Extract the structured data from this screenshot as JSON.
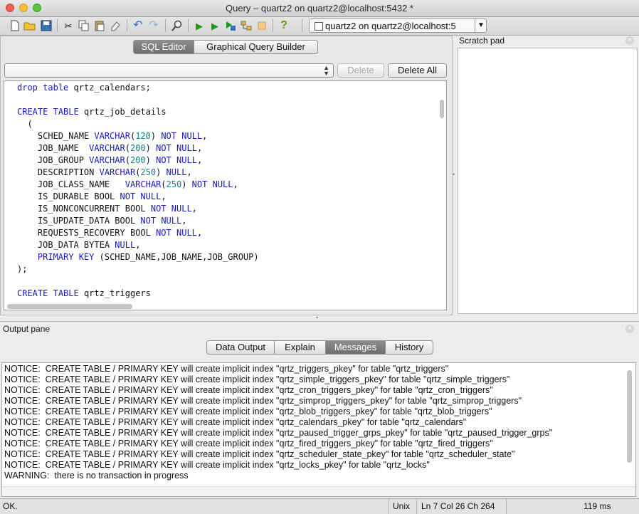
{
  "window": {
    "title": "Query – quartz2 on quartz2@localhost:5432 *"
  },
  "toolbar": {
    "icons": [
      "new-file-icon",
      "open-folder-icon",
      "save-icon",
      "cut-icon",
      "copy-icon",
      "paste-icon",
      "clear-icon",
      "undo-icon",
      "redo-icon",
      "find-icon",
      "execute-icon",
      "execute-pgscript-icon",
      "execute-to-file-icon",
      "explain-icon",
      "cancel-icon",
      "help-icon"
    ],
    "connection": "quartz2 on quartz2@localhost:5"
  },
  "editor": {
    "tabs": [
      {
        "label": "SQL Editor",
        "active": true
      },
      {
        "label": "Graphical Query Builder",
        "active": false
      }
    ],
    "delete_label": "Delete",
    "delete_all_label": "Delete All",
    "code": [
      [
        [
          "kw",
          "drop"
        ],
        [
          "t",
          " "
        ],
        [
          "kw",
          "table"
        ],
        [
          "t",
          " qrtz_calendars;"
        ]
      ],
      [],
      [
        [
          "kw",
          "CREATE"
        ],
        [
          "t",
          " "
        ],
        [
          "kw",
          "TABLE"
        ],
        [
          "t",
          " qrtz_job_details"
        ]
      ],
      [
        [
          "t",
          "  ("
        ]
      ],
      [
        [
          "t",
          "    SCHED_NAME "
        ],
        [
          "kw",
          "VARCHAR"
        ],
        [
          "t",
          "("
        ],
        [
          "num",
          "120"
        ],
        [
          "t",
          ") "
        ],
        [
          "kw",
          "NOT"
        ],
        [
          "t",
          " "
        ],
        [
          "kw",
          "NULL"
        ],
        [
          "t",
          ","
        ]
      ],
      [
        [
          "t",
          "    JOB_NAME  "
        ],
        [
          "kw",
          "VARCHAR"
        ],
        [
          "t",
          "("
        ],
        [
          "num",
          "200"
        ],
        [
          "t",
          ") "
        ],
        [
          "kw",
          "NOT"
        ],
        [
          "t",
          " "
        ],
        [
          "kw",
          "NULL"
        ],
        [
          "t",
          ","
        ]
      ],
      [
        [
          "t",
          "    JOB_GROUP "
        ],
        [
          "kw",
          "VARCHAR"
        ],
        [
          "t",
          "("
        ],
        [
          "num",
          "200"
        ],
        [
          "t",
          ") "
        ],
        [
          "kw",
          "NOT"
        ],
        [
          "t",
          " "
        ],
        [
          "kw",
          "NULL"
        ],
        [
          "t",
          ","
        ]
      ],
      [
        [
          "t",
          "    DESCRIPTION "
        ],
        [
          "kw",
          "VARCHAR"
        ],
        [
          "t",
          "("
        ],
        [
          "num",
          "250"
        ],
        [
          "t",
          ") "
        ],
        [
          "kw",
          "NULL"
        ],
        [
          "t",
          ","
        ]
      ],
      [
        [
          "t",
          "    JOB_CLASS_NAME   "
        ],
        [
          "kw",
          "VARCHAR"
        ],
        [
          "t",
          "("
        ],
        [
          "num",
          "250"
        ],
        [
          "t",
          ") "
        ],
        [
          "kw",
          "NOT"
        ],
        [
          "t",
          " "
        ],
        [
          "kw",
          "NULL"
        ],
        [
          "t",
          ","
        ]
      ],
      [
        [
          "t",
          "    IS_DURABLE BOOL "
        ],
        [
          "kw",
          "NOT"
        ],
        [
          "t",
          " "
        ],
        [
          "kw",
          "NULL"
        ],
        [
          "t",
          ","
        ]
      ],
      [
        [
          "t",
          "    IS_NONCONCURRENT BOOL "
        ],
        [
          "kw",
          "NOT"
        ],
        [
          "t",
          " "
        ],
        [
          "kw",
          "NULL"
        ],
        [
          "t",
          ","
        ]
      ],
      [
        [
          "t",
          "    IS_UPDATE_DATA BOOL "
        ],
        [
          "kw",
          "NOT"
        ],
        [
          "t",
          " "
        ],
        [
          "kw",
          "NULL"
        ],
        [
          "t",
          ","
        ]
      ],
      [
        [
          "t",
          "    REQUESTS_RECOVERY BOOL "
        ],
        [
          "kw",
          "NOT"
        ],
        [
          "t",
          " "
        ],
        [
          "kw",
          "NULL"
        ],
        [
          "t",
          ","
        ]
      ],
      [
        [
          "t",
          "    JOB_DATA BYTEA "
        ],
        [
          "kw",
          "NULL"
        ],
        [
          "t",
          ","
        ]
      ],
      [
        [
          "t",
          "    "
        ],
        [
          "kw",
          "PRIMARY"
        ],
        [
          "t",
          " "
        ],
        [
          "kw",
          "KEY"
        ],
        [
          "t",
          " (SCHED_NAME,JOB_NAME,JOB_GROUP)"
        ]
      ],
      [
        [
          "t",
          ");"
        ]
      ],
      [],
      [
        [
          "kw",
          "CREATE"
        ],
        [
          "t",
          " "
        ],
        [
          "kw",
          "TABLE"
        ],
        [
          "t",
          " qrtz_triggers"
        ]
      ]
    ]
  },
  "scratch": {
    "title": "Scratch pad"
  },
  "output": {
    "title": "Output pane",
    "tabs": [
      {
        "label": "Data Output",
        "active": false
      },
      {
        "label": "Explain",
        "active": false
      },
      {
        "label": "Messages",
        "active": true
      },
      {
        "label": "History",
        "active": false
      }
    ],
    "messages": [
      "NOTICE:  CREATE TABLE / PRIMARY KEY will create implicit index \"qrtz_triggers_pkey\" for table \"qrtz_triggers\"",
      "NOTICE:  CREATE TABLE / PRIMARY KEY will create implicit index \"qrtz_simple_triggers_pkey\" for table \"qrtz_simple_triggers\"",
      "NOTICE:  CREATE TABLE / PRIMARY KEY will create implicit index \"qrtz_cron_triggers_pkey\" for table \"qrtz_cron_triggers\"",
      "NOTICE:  CREATE TABLE / PRIMARY KEY will create implicit index \"qrtz_simprop_triggers_pkey\" for table \"qrtz_simprop_triggers\"",
      "NOTICE:  CREATE TABLE / PRIMARY KEY will create implicit index \"qrtz_blob_triggers_pkey\" for table \"qrtz_blob_triggers\"",
      "NOTICE:  CREATE TABLE / PRIMARY KEY will create implicit index \"qrtz_calendars_pkey\" for table \"qrtz_calendars\"",
      "NOTICE:  CREATE TABLE / PRIMARY KEY will create implicit index \"qrtz_paused_trigger_grps_pkey\" for table \"qrtz_paused_trigger_grps\"",
      "NOTICE:  CREATE TABLE / PRIMARY KEY will create implicit index \"qrtz_fired_triggers_pkey\" for table \"qrtz_fired_triggers\"",
      "NOTICE:  CREATE TABLE / PRIMARY KEY will create implicit index \"qrtz_scheduler_state_pkey\" for table \"qrtz_scheduler_state\"",
      "NOTICE:  CREATE TABLE / PRIMARY KEY will create implicit index \"qrtz_locks_pkey\" for table \"qrtz_locks\"",
      "WARNING:  there is no transaction in progress"
    ]
  },
  "status": {
    "state": "OK.",
    "eol": "Unix",
    "position": "Ln 7 Col 26 Ch 264",
    "duration": "119 ms"
  }
}
